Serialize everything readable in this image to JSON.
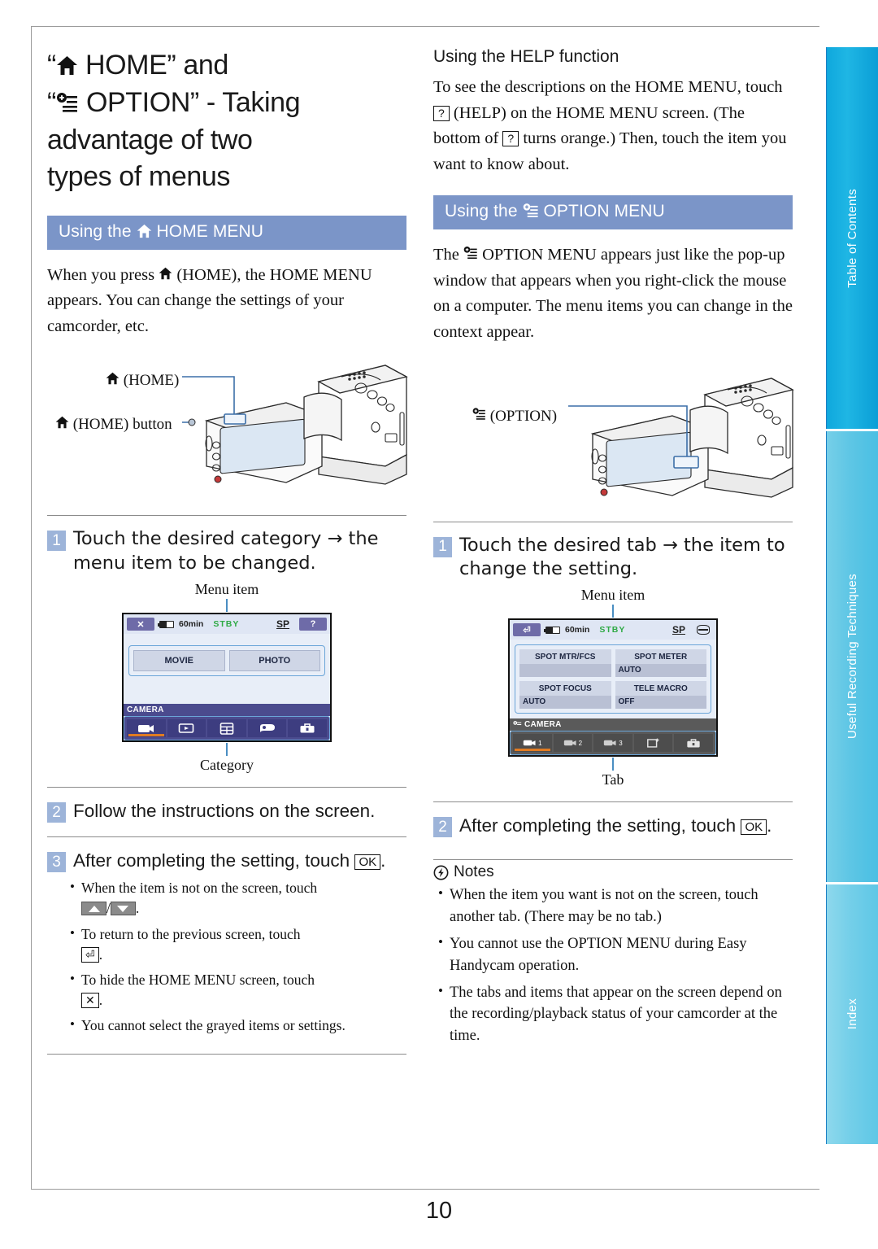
{
  "page": {
    "number": "10"
  },
  "side_tabs": [
    {
      "label": "Table of Contents"
    },
    {
      "label": "Useful Recording Techniques"
    },
    {
      "label": "Index"
    }
  ],
  "title": {
    "line1_pre": "“",
    "line1_post": " HOME” and",
    "line2_pre": "“",
    "line2_post": " OPTION” - Taking",
    "line3": "advantage of two",
    "line4": "types of menus"
  },
  "left_column": {
    "section_bar": {
      "pre": "Using the ",
      "post": " HOME MENU"
    },
    "intro_pre": "When you press ",
    "intro_post": " (HOME), the HOME MENU appears. You can change the settings of your camcorder, etc.",
    "figure": {
      "label_top": " (HOME)",
      "label_bottom": " (HOME) button"
    },
    "steps": [
      {
        "num": "1",
        "text": "Touch the desired category → the menu item to be changed."
      },
      {
        "num": "2",
        "text": "Follow the instructions on the screen."
      },
      {
        "num": "3",
        "text_pre": "After completing the setting, touch ",
        "key": "OK",
        "text_post": "."
      }
    ],
    "lcd": {
      "caption_top": "Menu item",
      "caption_bottom": "Category",
      "status": {
        "left_button": "close-icon",
        "battery": "60min",
        "standby": "STBY",
        "quality": "SP",
        "right_button": "?"
      },
      "items": [
        "MOVIE",
        "PHOTO"
      ],
      "category_label": "CAMERA",
      "tabs": [
        {
          "icon": "camera-icon",
          "active": true
        },
        {
          "icon": "playback-icon",
          "active": false
        },
        {
          "icon": "manage-media-icon",
          "active": false
        },
        {
          "icon": "others-icon",
          "active": false
        },
        {
          "icon": "settings-icon",
          "active": false
        }
      ]
    },
    "bullets": [
      {
        "pre": "When the item is not on the screen, touch ",
        "keys": "up-down-arrows",
        "post": "."
      },
      {
        "pre": "To return to the previous screen, touch ",
        "keys": "back-arrow",
        "post": "."
      },
      {
        "pre": "To hide the HOME MENU screen, touch ",
        "keys": "close-x",
        "post": "."
      },
      {
        "pre": "You cannot select the grayed items or settings.",
        "keys": "",
        "post": ""
      }
    ]
  },
  "right_column": {
    "help_heading": "Using the HELP function",
    "help_text_a": "To see the descriptions on the HOME MENU, touch ",
    "help_key_1": "?",
    "help_text_b": " (HELP) on the HOME MENU screen. (The bottom of ",
    "help_key_2": "?",
    "help_text_c": " turns orange.) Then, touch the item you want to know about.",
    "section_bar": {
      "pre": "Using the ",
      "post": " OPTION MENU"
    },
    "intro_pre": "The ",
    "intro_post": " OPTION MENU appears just like the pop-up window that appears when you right-click the mouse on a computer. The menu items you can change in the context appear.",
    "figure": {
      "label_top": " (OPTION)"
    },
    "steps": [
      {
        "num": "1",
        "text": "Touch the desired tab → the item to change the setting."
      },
      {
        "num": "2",
        "text_pre": "After completing the setting, touch ",
        "key": "OK",
        "text_post": "."
      }
    ],
    "lcd": {
      "caption_top": "Menu item",
      "caption_bottom": "Tab",
      "status": {
        "left_button": "back-arrow-icon",
        "battery": "60min",
        "standby": "STBY",
        "quality": "SP",
        "media": "media-icon"
      },
      "items": [
        {
          "label": "SPOT MTR/FCS",
          "value": ""
        },
        {
          "label": "SPOT METER",
          "value": "AUTO"
        },
        {
          "label": "SPOT FOCUS",
          "value": "AUTO"
        },
        {
          "label": "TELE MACRO",
          "value": "OFF"
        }
      ],
      "category_label": "CAMERA",
      "tabs": [
        {
          "icon": "camera-icon",
          "sub": "1",
          "active": true
        },
        {
          "icon": "camera-icon",
          "sub": "2",
          "active": false
        },
        {
          "icon": "camera-icon",
          "sub": "3",
          "active": false
        },
        {
          "icon": "effect-icon",
          "sub": "",
          "active": false
        },
        {
          "icon": "settings-icon",
          "sub": "",
          "active": false
        }
      ]
    },
    "notes_heading": "Notes",
    "notes": [
      "When the item you want is not on the screen, touch another tab. (There may be no tab.)",
      "You cannot use the OPTION MENU during Easy Handycam operation.",
      "The tabs and items that appear on the screen depend on the recording/playback status of your camcorder at the time."
    ]
  },
  "colors": {
    "section_bar": "#7b95c8",
    "step_num": "#9db4d9",
    "tab_toc": "#0fa8dd",
    "tab_useful": "#5ec6e5",
    "tab_index": "#74cfe9",
    "orange_accent": "#e07b22",
    "stby_green": "#2faa45"
  }
}
